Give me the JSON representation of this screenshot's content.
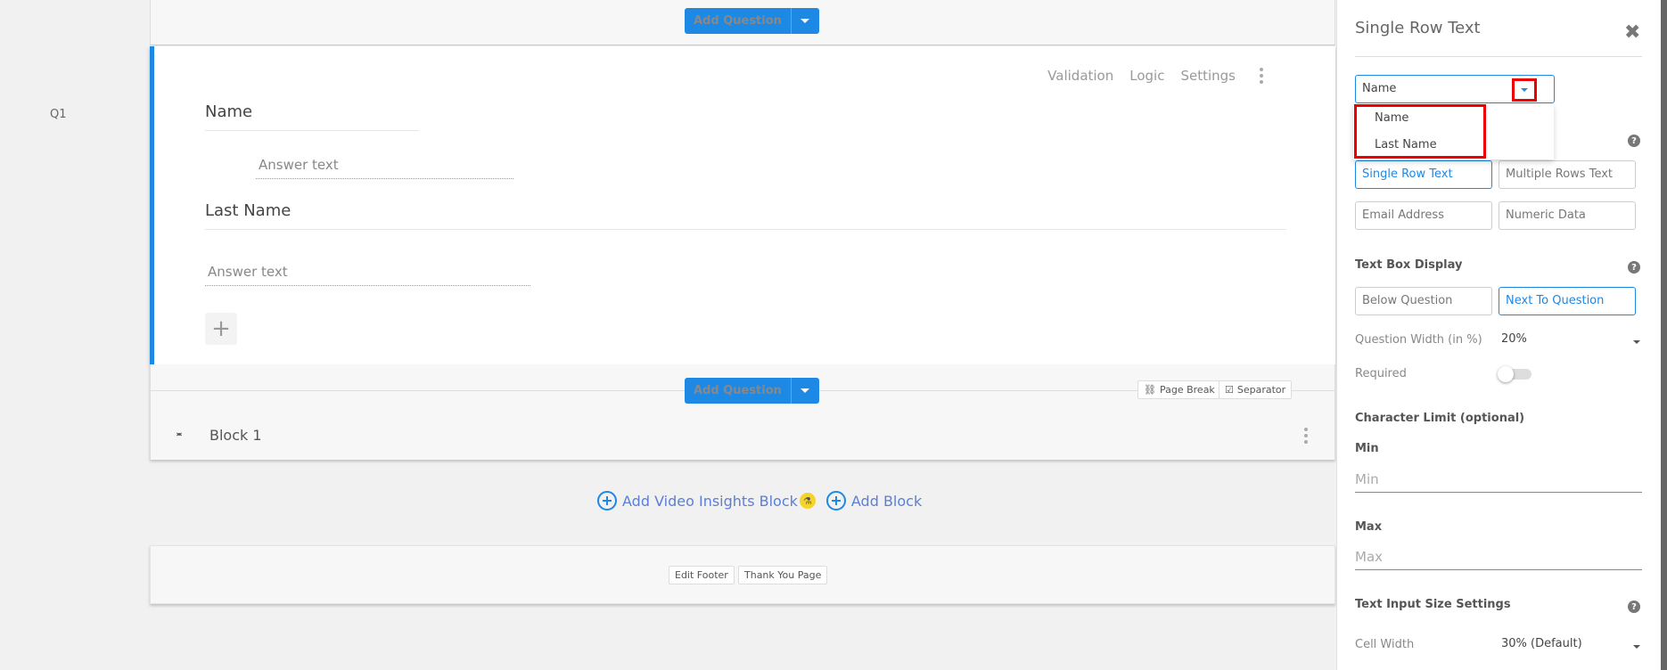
{
  "canvas": {
    "question_number": "Q1",
    "add_question_label": "Add Question",
    "question_tools": [
      "Validation",
      "Logic",
      "Settings"
    ],
    "questions": [
      {
        "title": "Name",
        "answer_placeholder": "Answer text"
      },
      {
        "title": "Last Name",
        "answer_placeholder": "Answer text"
      }
    ],
    "page_break_label": "Page Break",
    "separator_label": "Separator",
    "block_title": "Block 1",
    "add_video_insights_label": "Add Video Insights Block",
    "add_block_label": "Add Block",
    "edit_footer_label": "Edit Footer",
    "thank_you_label": "Thank You Page"
  },
  "panel": {
    "title": "Single Row Text",
    "field_select": {
      "selected": "Name",
      "options": [
        "Name",
        "Last Name"
      ]
    },
    "text_types": [
      {
        "label": "Single Row Text",
        "selected": true
      },
      {
        "label": "Multiple Rows Text",
        "selected": false
      },
      {
        "label": "Email Address",
        "selected": false
      },
      {
        "label": "Numeric Data",
        "selected": false
      }
    ],
    "text_box_display_title": "Text Box Display",
    "display_options": [
      {
        "label": "Below Question",
        "selected": false
      },
      {
        "label": "Next To Question",
        "selected": true
      }
    ],
    "question_width_label": "Question Width (in %)",
    "question_width_value": "20%",
    "required_label": "Required",
    "required_on": false,
    "char_limit_title": "Character Limit (optional)",
    "min_label": "Min",
    "min_placeholder": "Min",
    "max_label": "Max",
    "max_placeholder": "Max",
    "size_settings_title": "Text Input Size Settings",
    "cell_width_label": "Cell Width",
    "cell_width_value": "30% (Default)",
    "highlight_color": "#e00000",
    "accent_color": "#1e88e5"
  }
}
